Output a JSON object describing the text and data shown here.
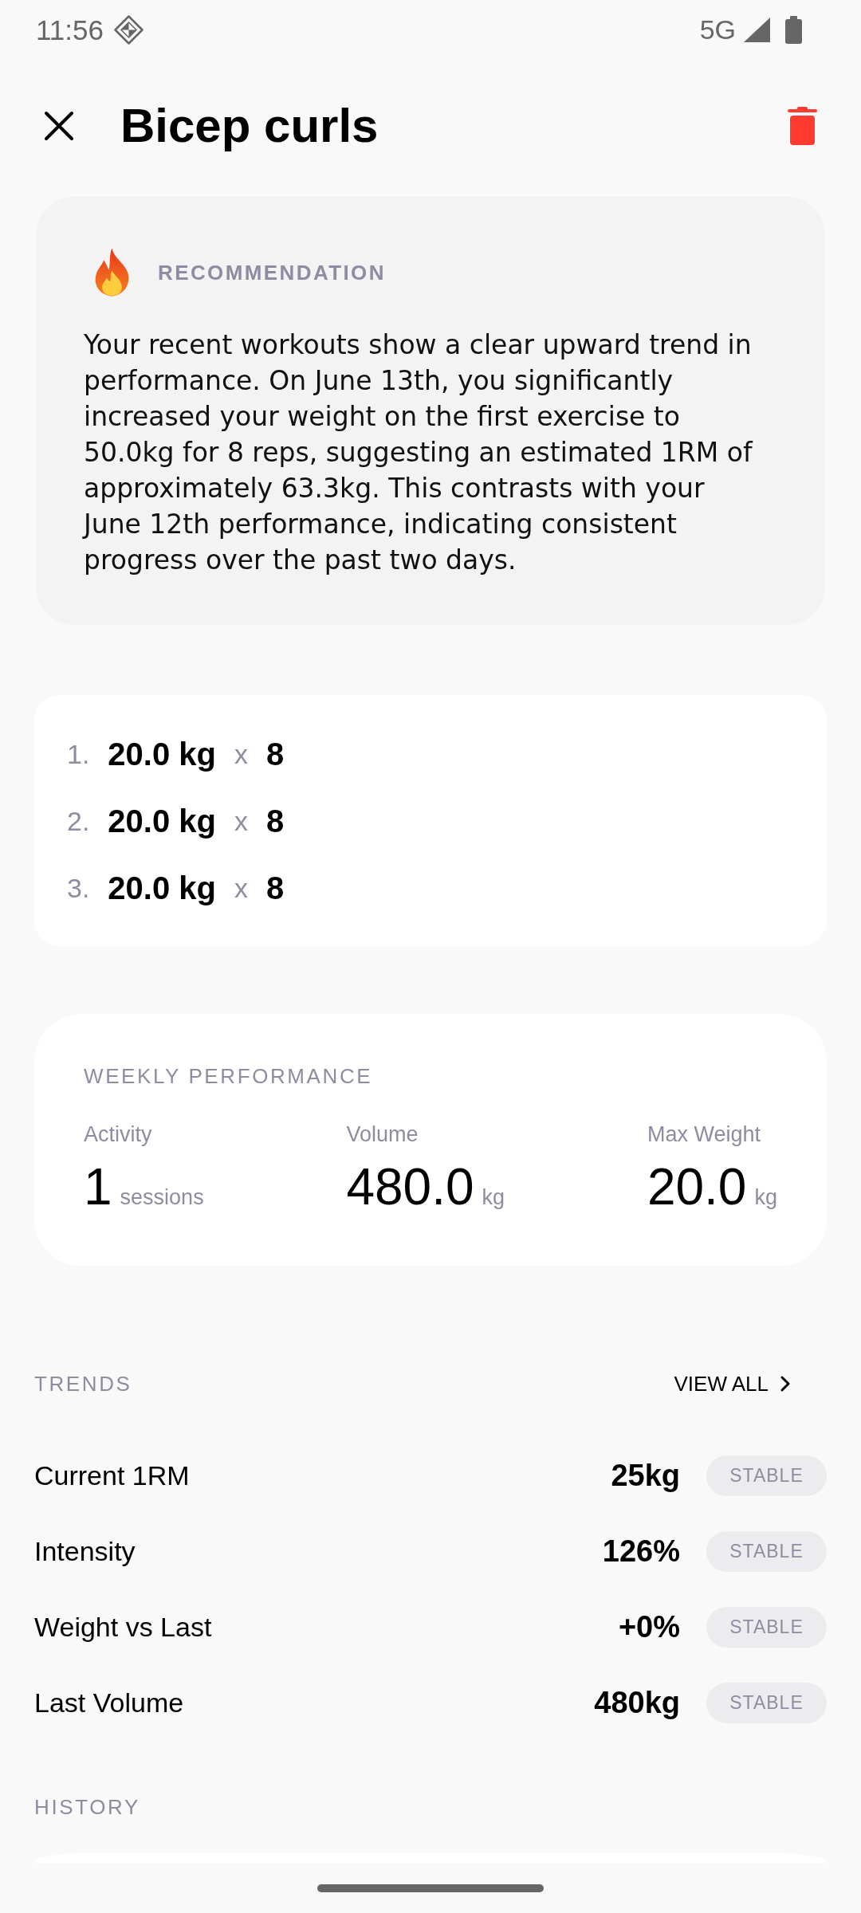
{
  "status_bar": {
    "time": "11:56",
    "network": "5G"
  },
  "header": {
    "title": "Bicep curls"
  },
  "recommendation": {
    "label": "RECOMMENDATION",
    "text": "Your recent workouts show a clear upward trend in performance. On June 13th, you significantly increased your weight on the first exercise to 50.0kg for 8 reps, suggesting an estimated 1RM of approximately 63.3kg. This contrasts with your June 12th performance, indicating consistent progress over the past two days."
  },
  "sets": [
    {
      "number": "1.",
      "weight": "20.0 kg",
      "times": "x",
      "reps": "8"
    },
    {
      "number": "2.",
      "weight": "20.0 kg",
      "times": "x",
      "reps": "8"
    },
    {
      "number": "3.",
      "weight": "20.0 kg",
      "times": "x",
      "reps": "8"
    }
  ],
  "weekly_performance": {
    "title": "WEEKLY PERFORMANCE",
    "stats": [
      {
        "label": "Activity",
        "value": "1",
        "unit": "sessions"
      },
      {
        "label": "Volume",
        "value": "480.0",
        "unit": "kg"
      },
      {
        "label": "Max Weight",
        "value": "20.0",
        "unit": "kg"
      }
    ]
  },
  "trends": {
    "title": "TRENDS",
    "view_all": "VIEW ALL",
    "rows": [
      {
        "label": "Current 1RM",
        "value": "25kg",
        "badge": "STABLE"
      },
      {
        "label": "Intensity",
        "value": "126%",
        "badge": "STABLE"
      },
      {
        "label": "Weight vs Last",
        "value": "+0%",
        "badge": "STABLE"
      },
      {
        "label": "Last Volume",
        "value": "480kg",
        "badge": "STABLE"
      }
    ]
  },
  "history": {
    "title": "HISTORY"
  }
}
